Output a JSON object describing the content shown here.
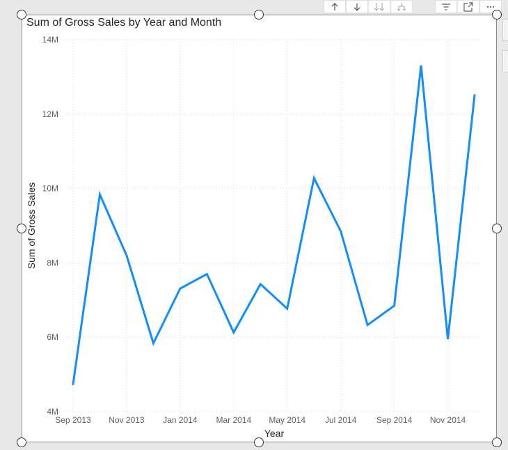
{
  "visual": {
    "title": "Sum of Gross Sales by Year and Month",
    "header_icons": [
      "arrow-up-icon",
      "arrow-down-icon",
      "double-arrow-down-icon",
      "expand-hierarchy-icon",
      "filter-icon",
      "focus-mode-icon",
      "more-options-icon"
    ]
  },
  "chart_data": {
    "type": "line",
    "title": "Sum of Gross Sales by Year and Month",
    "xlabel": "Year",
    "ylabel": "Sum of Gross Sales",
    "x": [
      "Sep 2013",
      "Oct 2013",
      "Nov 2013",
      "Dec 2013",
      "Jan 2014",
      "Feb 2014",
      "Mar 2014",
      "Apr 2014",
      "May 2014",
      "Jun 2014",
      "Jul 2014",
      "Aug 2014",
      "Sep 2014",
      "Oct 2014",
      "Nov 2014",
      "Dec 2014"
    ],
    "x_tick_labels": [
      "Sep 2013",
      "Nov 2013",
      "Jan 2014",
      "Mar 2014",
      "May 2014",
      "Jul 2014",
      "Sep 2014",
      "Nov 2014"
    ],
    "series": [
      {
        "values": [
          4.74,
          9.84,
          8.2,
          5.84,
          7.31,
          7.7,
          6.13,
          7.43,
          6.77,
          10.28,
          8.85,
          6.33,
          6.85,
          13.31,
          5.95,
          12.51
        ],
        "color": "#118dff"
      }
    ],
    "y_unit_suffix": "M",
    "y_ticks": [
      4,
      6,
      8,
      10,
      12,
      14
    ],
    "y_tick_labels": [
      "4M",
      "6M",
      "8M",
      "10M",
      "12M",
      "14M"
    ],
    "ylim": [
      4,
      14
    ],
    "grid": true
  }
}
